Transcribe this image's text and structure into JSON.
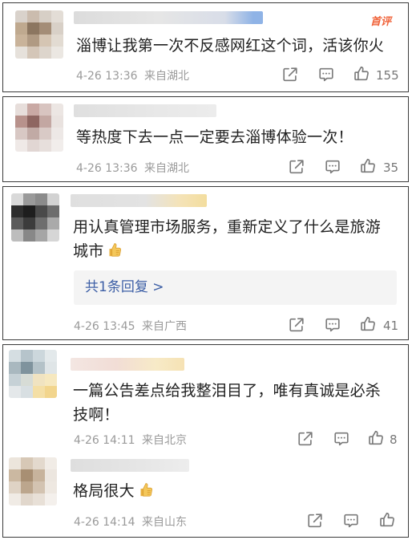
{
  "comments": [
    {
      "text": "淄博让我第一次不反感网红这个词，活该你火",
      "date": "4-26 13:36",
      "location": "来自湖北",
      "likes": "155",
      "badge": "首评"
    },
    {
      "text": "等热度下去一点一定要去淄博体验一次！",
      "date": "4-26 13:36",
      "location": "来自湖北",
      "likes": "35"
    },
    {
      "text_line1": "用认真管理市场服务，重新定义了什么是旅游",
      "text_line2": "城市",
      "reply_label": "共1条回复 >",
      "date": "4-26 13:45",
      "location": "来自广西",
      "likes": "41"
    },
    {
      "text_line1": "一篇公告差点给我整泪目了，唯有真诚是必杀",
      "text_line2": "技啊！",
      "date": "4-26 14:11",
      "location": "来自北京",
      "likes": "8"
    },
    {
      "text": "格局很大",
      "date": "4-26 14:14",
      "location": "来自山东",
      "likes": ""
    }
  ],
  "icons": [
    "share-icon",
    "comment-icon",
    "like-icon",
    "thumbs-up-emoji"
  ],
  "colors": {
    "badge": "#f0633a",
    "reply_link": "#3d5fa6",
    "meta": "#9a9a9a"
  }
}
